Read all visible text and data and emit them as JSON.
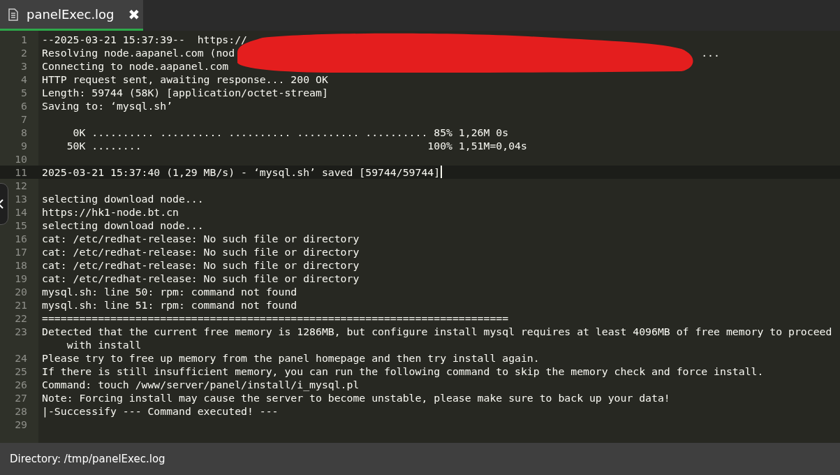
{
  "tab": {
    "title": "panelExec.log",
    "close": "✖",
    "selected": true
  },
  "lines": [
    {
      "number": "1",
      "text": "--2025-03-21 15:37:39--  https://",
      "current": false
    },
    {
      "number": "2",
      "text": "Resolving node.aapanel.com (nod",
      "tail": "...",
      "current": false
    },
    {
      "number": "3",
      "text": "Connecting to node.aapanel.com",
      "current": false
    },
    {
      "number": "4",
      "text": "HTTP request sent, awaiting response... 200 OK",
      "current": false
    },
    {
      "number": "5",
      "text": "Length: 59744 (58K) [application/octet-stream]",
      "current": false
    },
    {
      "number": "6",
      "text": "Saving to: ‘mysql.sh’",
      "current": false
    },
    {
      "number": "7",
      "current": false
    },
    {
      "number": "8",
      "text": "     0K .......... .......... .......... .......... .......... 85% 1,26M 0s",
      "current": false
    },
    {
      "number": "9",
      "text": "    50K ........                                              100% 1,51M=0,04s",
      "current": false
    },
    {
      "number": "10",
      "current": false
    },
    {
      "number": "11",
      "text": "2025-03-21 15:37:40 (1,29 MB/s) - ‘mysql.sh’ saved [59744/59744]",
      "current": true
    },
    {
      "number": "12",
      "current": false
    },
    {
      "number": "13",
      "text": "selecting download node...",
      "current": false
    },
    {
      "number": "14",
      "text": "https://hk1-node.bt.cn",
      "current": false
    },
    {
      "number": "15",
      "text": "selecting download node...",
      "current": false
    },
    {
      "number": "16",
      "text": "cat: /etc/redhat-release: No such file or directory",
      "current": false
    },
    {
      "number": "17",
      "text": "cat: /etc/redhat-release: No such file or directory",
      "current": false
    },
    {
      "number": "18",
      "text": "cat: /etc/redhat-release: No such file or directory",
      "current": false
    },
    {
      "number": "19",
      "text": "cat: /etc/redhat-release: No such file or directory",
      "current": false
    },
    {
      "number": "20",
      "text": "mysql.sh: line 50: rpm: command not found",
      "current": false
    },
    {
      "number": "21",
      "text": "mysql.sh: line 51: rpm: command not found",
      "current": false
    },
    {
      "number": "22",
      "text": "===========================================================================",
      "current": false
    },
    {
      "number": "23",
      "text": "Detected that the current free memory is 1286MB, but configure install mysql requires at least 4096MB of free memory to proceed with install",
      "current": false
    },
    {
      "number": "24",
      "text": "Please try to free up memory from the panel homepage and then try install again.",
      "current": false
    },
    {
      "number": "25",
      "text": "If there is still insufficient memory, you can run the following command to skip the memory check and force install.",
      "current": false
    },
    {
      "number": "26",
      "text": "Command: touch /www/server/panel/install/i_mysql.pl",
      "current": false
    },
    {
      "number": "27",
      "text": "Note: Forcing install may cause the server to become unstable, please make sure to back up your data!",
      "current": false
    },
    {
      "number": "28",
      "text": "|-Successify --- Command executed! ---",
      "current": false
    },
    {
      "number": "29",
      "current": false
    }
  ],
  "status_bar": {
    "directory": "Directory: /tmp/panelExec.log"
  }
}
